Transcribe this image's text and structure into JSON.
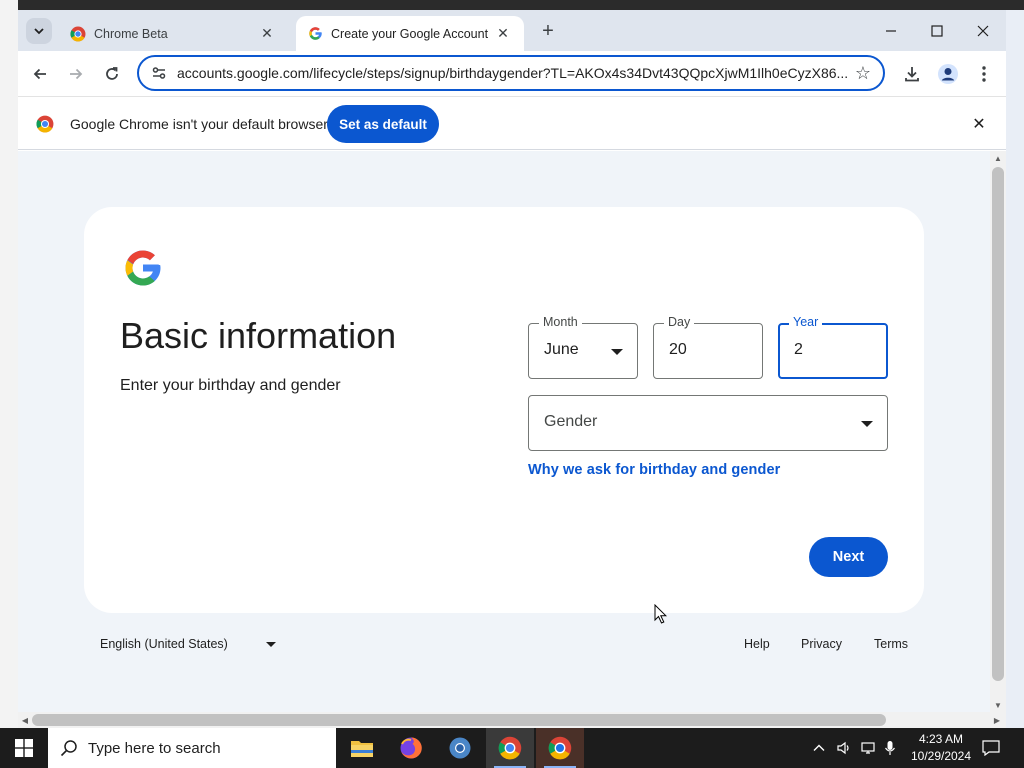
{
  "browser": {
    "tabs": [
      {
        "label": "Chrome Beta",
        "favicon": "chrome-beta-icon",
        "active": false
      },
      {
        "label": "Create your Google Account",
        "favicon": "google-icon",
        "active": true
      }
    ],
    "address_bar": {
      "url": "accounts.google.com/lifecycle/steps/signup/birthdaygender?TL=AKOx4s34Dvt43QQpcXjwM1Ilh0eCyzX86..."
    },
    "infobar": {
      "message": "Google Chrome isn't your default browser",
      "button_label": "Set as default"
    }
  },
  "page": {
    "title": "Basic information",
    "subtitle": "Enter your birthday and gender",
    "fields": {
      "month": {
        "label": "Month",
        "value": "June"
      },
      "day": {
        "label": "Day",
        "value": "20"
      },
      "year": {
        "label": "Year",
        "value": "2"
      },
      "gender": {
        "placeholder": "Gender"
      }
    },
    "why_link": "Why we ask for birthday and gender",
    "next_label": "Next"
  },
  "footer": {
    "language": "English (United States)",
    "links": [
      "Help",
      "Privacy",
      "Terms"
    ]
  },
  "taskbar": {
    "search_placeholder": "Type here to search",
    "time": "4:23 AM",
    "date": "10/29/2024"
  },
  "colors": {
    "accent": "#0b57d0",
    "page_background": "#f0f4f9",
    "taskbar": "#1c1c1c"
  }
}
